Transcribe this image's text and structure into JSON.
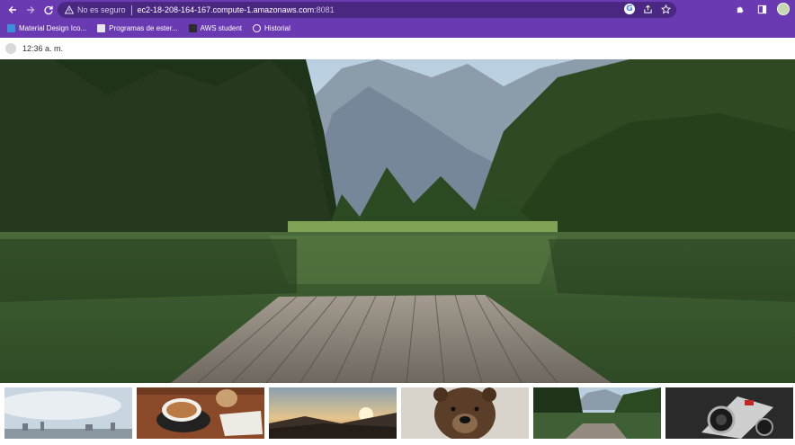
{
  "browser": {
    "security_label": "No es seguro",
    "url_host": "ec2-18-208-164-167.compute-1.amazonaws.com",
    "url_port": ":8081",
    "bookmarks": [
      {
        "label": "Material Design Ico...",
        "icon": "material-design-icon"
      },
      {
        "label": "Programas de ester...",
        "icon": "page-icon"
      },
      {
        "label": "AWS student",
        "icon": "aws-icon"
      },
      {
        "label": "Historial",
        "icon": "history-icon"
      }
    ],
    "accent_color": "#6a3ab2"
  },
  "page": {
    "time": "12:36 a. m.",
    "hero_image": "mountain-lake-pier",
    "thumbnails": [
      {
        "name": "city-skyline"
      },
      {
        "name": "coffee-cup"
      },
      {
        "name": "sunset-hills"
      },
      {
        "name": "bear"
      },
      {
        "name": "lake-pier"
      },
      {
        "name": "camera"
      }
    ]
  }
}
